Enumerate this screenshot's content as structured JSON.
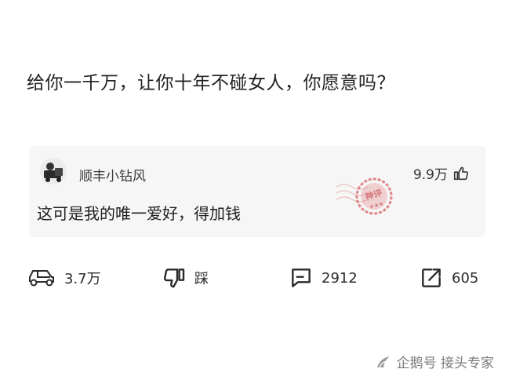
{
  "question": {
    "title": "给你一千万，让你十年不碰女人，你愿意吗？"
  },
  "comment": {
    "author": "顺丰小钻风",
    "likes": "9.9万",
    "text": "这可是我的唯一爱好，得加钱",
    "badge": "神评",
    "icons": {
      "avatar": "avatar",
      "like": "thumb-up-icon",
      "badge": "god-comment-stamp"
    }
  },
  "actions": {
    "repost_count": "3.7万",
    "dislike_label": "踩",
    "comment_count": "2912",
    "share_count": "605",
    "icons": {
      "repost": "car-icon",
      "dislike": "thumb-down-icon",
      "comment": "comment-bubble-icon",
      "share": "share-icon"
    }
  },
  "watermark": {
    "text": "企鹅号 接头专家"
  },
  "colors": {
    "stamp": "#d7575d",
    "card": "#f6f6f6",
    "text": "#222222"
  }
}
